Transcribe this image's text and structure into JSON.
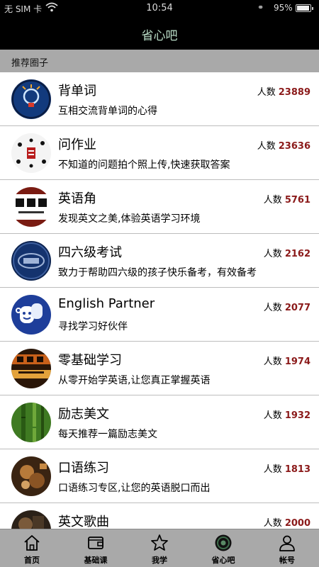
{
  "status_bar": {
    "carrier": "无 SIM 卡",
    "time": "10:54",
    "battery": "95%",
    "battery_level": 0.95
  },
  "nav": {
    "title": "省心吧"
  },
  "section": {
    "title": "推荐圈子"
  },
  "groups": [
    {
      "name": "背单词",
      "desc": "互相交流背单词的心得",
      "count_label": "人数",
      "count": "23889",
      "avatar": "lightbulb-avatar"
    },
    {
      "name": "问作业",
      "desc": "不知道的问题拍个照上传,快速获取答案",
      "count_label": "人数",
      "count": "23636",
      "avatar": "homework-avatar"
    },
    {
      "name": "英语角",
      "desc": "发现英文之美,体验英语学习环境",
      "count_label": "人数",
      "count": "5761",
      "avatar": "english-corner-avatar"
    },
    {
      "name": "四六级考试",
      "desc": "致力于帮助四六级的孩子快乐备考，有效备考",
      "count_label": "人数",
      "count": "2162",
      "avatar": "cet-avatar"
    },
    {
      "name": "English Partner",
      "desc": "寻找学习好伙伴",
      "count_label": "人数",
      "count": "2077",
      "avatar": "partner-avatar"
    },
    {
      "name": "零基础学习",
      "desc": "从零开始学英语,让您真正掌握英语",
      "count_label": "人数",
      "count": "1974",
      "avatar": "zero-basis-avatar"
    },
    {
      "name": "励志美文",
      "desc": "每天推荐一篇励志美文",
      "count_label": "人数",
      "count": "1932",
      "avatar": "bamboo-avatar"
    },
    {
      "name": "口语练习",
      "desc": "口语练习专区,让您的英语脱口而出",
      "count_label": "人数",
      "count": "1813",
      "avatar": "speaking-avatar"
    },
    {
      "name": "英文歌曲",
      "desc": "",
      "count_label": "人数",
      "count": "2000",
      "avatar": "songs-avatar"
    }
  ],
  "tabs": [
    {
      "label": "首页",
      "icon": "home-icon"
    },
    {
      "label": "基础课",
      "icon": "wallet-icon"
    },
    {
      "label": "我学",
      "icon": "star-icon"
    },
    {
      "label": "省心吧",
      "icon": "community-icon",
      "active": true
    },
    {
      "label": "帐号",
      "icon": "person-icon"
    }
  ]
}
